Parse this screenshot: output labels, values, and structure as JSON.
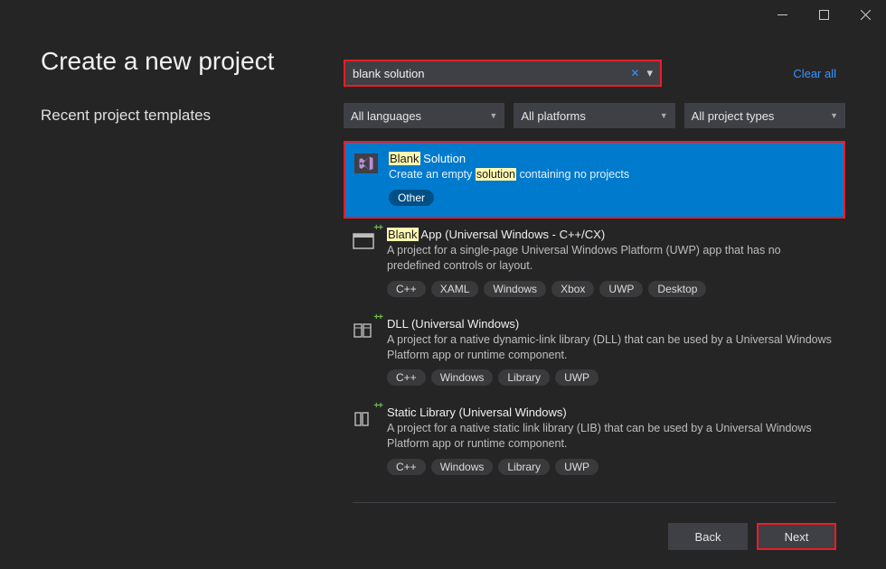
{
  "title": "Create a new project",
  "recent_label": "Recent project templates",
  "search": {
    "value": "blank solution",
    "clear_all_label": "Clear all"
  },
  "filters": [
    {
      "label": "All languages"
    },
    {
      "label": "All platforms"
    },
    {
      "label": "All project types"
    }
  ],
  "results": [
    {
      "title_pre": "",
      "title_hl": "Blank",
      "title_mid": " Solution",
      "title_post": "",
      "desc_pre": "Create an empty ",
      "desc_hl": "solution",
      "desc_post": " containing no projects",
      "tags": [
        "Other"
      ],
      "selected": true
    },
    {
      "title_pre": "",
      "title_hl": "Blank",
      "title_mid": " App (Universal Windows - C++/CX)",
      "title_post": "",
      "desc_pre": "A project for a single-page Universal Windows Platform (UWP) app that has no predefined controls or layout.",
      "desc_hl": "",
      "desc_post": "",
      "tags": [
        "C++",
        "XAML",
        "Windows",
        "Xbox",
        "UWP",
        "Desktop"
      ],
      "selected": false
    },
    {
      "title_pre": "DLL (Universal Windows)",
      "title_hl": "",
      "title_mid": "",
      "title_post": "",
      "desc_pre": "A project for a native dynamic-link library (DLL) that can be used by a Universal Windows Platform app or runtime component.",
      "desc_hl": "",
      "desc_post": "",
      "tags": [
        "C++",
        "Windows",
        "Library",
        "UWP"
      ],
      "selected": false
    },
    {
      "title_pre": "Static Library (Universal Windows)",
      "title_hl": "",
      "title_mid": "",
      "title_post": "",
      "desc_pre": "A project for a native static link library (LIB) that can be used by a Universal Windows Platform app or runtime component.",
      "desc_hl": "",
      "desc_post": "",
      "tags": [
        "C++",
        "Windows",
        "Library",
        "UWP"
      ],
      "selected": false
    }
  ],
  "buttons": {
    "back": "Back",
    "next": "Next"
  }
}
